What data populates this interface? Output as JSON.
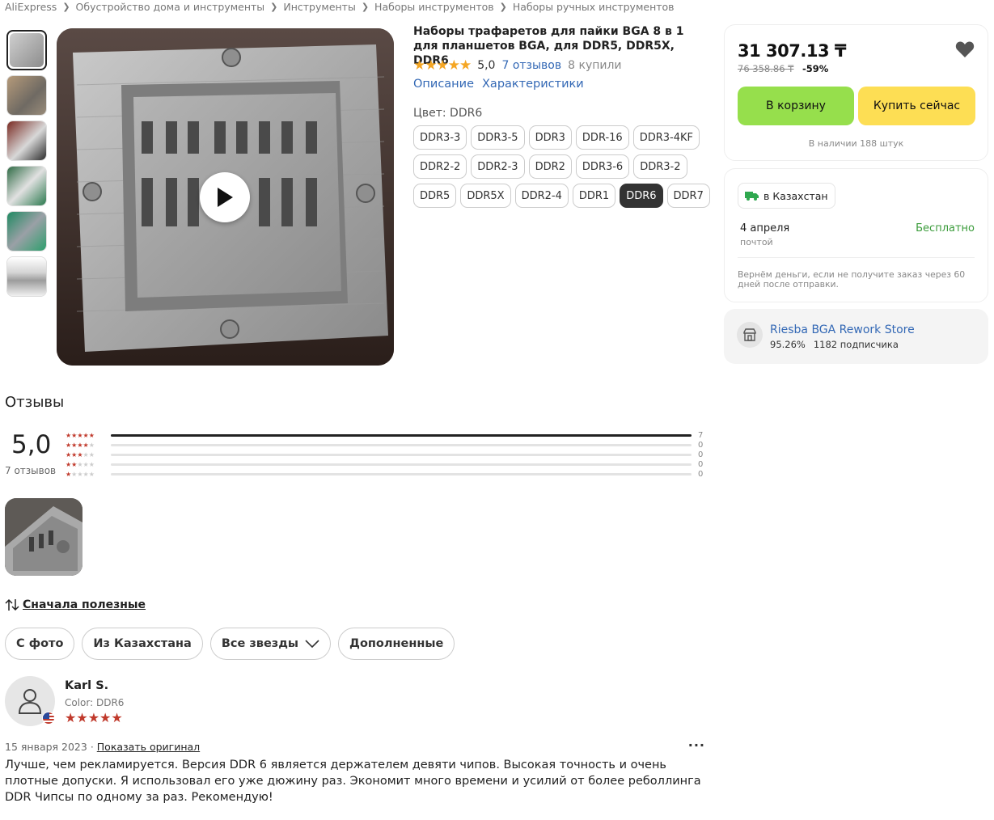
{
  "breadcrumb": [
    "AliExpress",
    "Обустройство дома и инструменты",
    "Инструменты",
    "Наборы инструментов",
    "Наборы ручных инструментов"
  ],
  "product": {
    "title": "Наборы трафаретов для пайки BGA 8 в 1 для планшетов BGA, для DDR5, DDR5X, DDR6",
    "rating_score": "5,0",
    "reviews_link": "7 отзывов",
    "sold": "8 купили",
    "tab_description": "Описание",
    "tab_specs": "Характеристики",
    "color_label": "Цвет: DDR6",
    "variants": [
      [
        "DDR3-3",
        "DDR3-5",
        "DDR3",
        "DDR-16",
        "DDR3-4KF"
      ],
      [
        "DDR2-2",
        "DDR2-3",
        "DDR2",
        "DDR3-6",
        "DDR3-2"
      ],
      [
        "DDR5",
        "DDR5X",
        "DDR2-4",
        "DDR1",
        "DDR6",
        "DDR7"
      ]
    ],
    "selected_variant": "DDR6"
  },
  "buy": {
    "price": "31 307.13 ₸",
    "old_price": "76 358.86 ₸",
    "discount": "-59%",
    "cart_label": "В корзину",
    "buy_label": "Купить сейчас",
    "stock": "В наличии 188 штук"
  },
  "shipping": {
    "destination": "в Казахстан",
    "date": "4 апреля",
    "method": "почтой",
    "price": "Бесплатно",
    "note": "Вернём деньги, если не получите заказ через 60 дней после отправки."
  },
  "store": {
    "name": "Riesba BGA Rework Store",
    "rating": "95.26%",
    "followers": "1182 подписчика"
  },
  "reviews": {
    "heading": "Отзывы",
    "avg": "5,0",
    "count": "7 отзывов",
    "histogram": [
      {
        "stars": 5,
        "count": "7",
        "fraction": 1.0
      },
      {
        "stars": 4,
        "count": "0",
        "fraction": 0
      },
      {
        "stars": 3,
        "count": "0",
        "fraction": 0
      },
      {
        "stars": 2,
        "count": "0",
        "fraction": 0
      },
      {
        "stars": 1,
        "count": "0",
        "fraction": 0
      }
    ],
    "sort_label": "Сначала полезные",
    "filters": [
      "С фото",
      "Из Казахстана",
      "Все звезды",
      "Дополненные"
    ],
    "items": [
      {
        "author": "Karl S.",
        "color": "Color: DDR6",
        "stars": 5,
        "date": "15 января 2023",
        "show_original": "Показать оригинал",
        "text": "Лучше, чем рекламируется. Версия DDR 6 является держателем девяти чипов. Высокая точность и очень плотные допуски. Я использовал его уже дюжину раз. Экономит много времени и усилий от более реболлинга DDR Чипсы по одному за раз. Рекомендую!"
      }
    ]
  },
  "colors": {
    "link": "#3368b5",
    "cart_button": "#96df4c",
    "buy_button": "#fdde54",
    "star": "#f5a623",
    "review_star": "#c0392b",
    "free_shipping": "#3a9b3a"
  }
}
